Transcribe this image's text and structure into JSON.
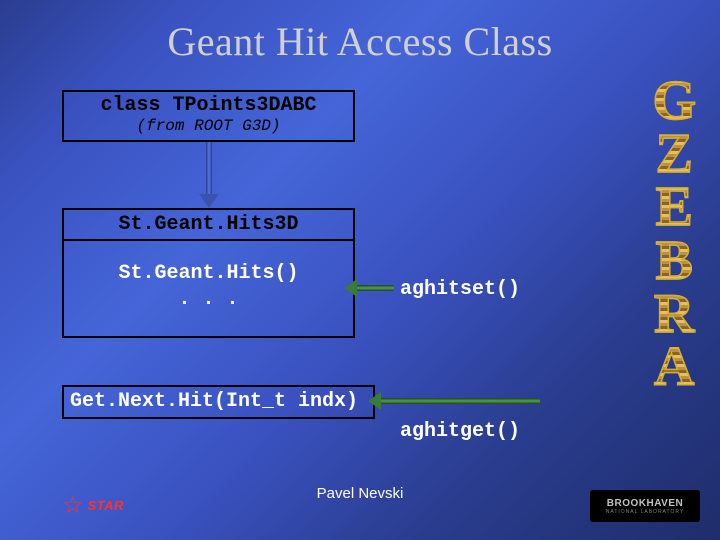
{
  "title": "Geant Hit Access Class",
  "side_label": "GZEBRA",
  "class_box": {
    "declaration": "class TPoints3DABC",
    "from": "(from ROOT G3D)"
  },
  "geant_box": {
    "head": "St.Geant.Hits3D",
    "line1": "St.Geant.Hits()",
    "line2": ". . ."
  },
  "getnext_box": "Get.Next.Hit(Int_t indx)",
  "labels": {
    "aghitset": "aghitset()",
    "aghitget": "aghitget()"
  },
  "footer": {
    "author": "Pavel Nevski",
    "star": "STAR",
    "lab": "BROOKHAVEN",
    "lab_sub": "NATIONAL LABORATORY"
  }
}
